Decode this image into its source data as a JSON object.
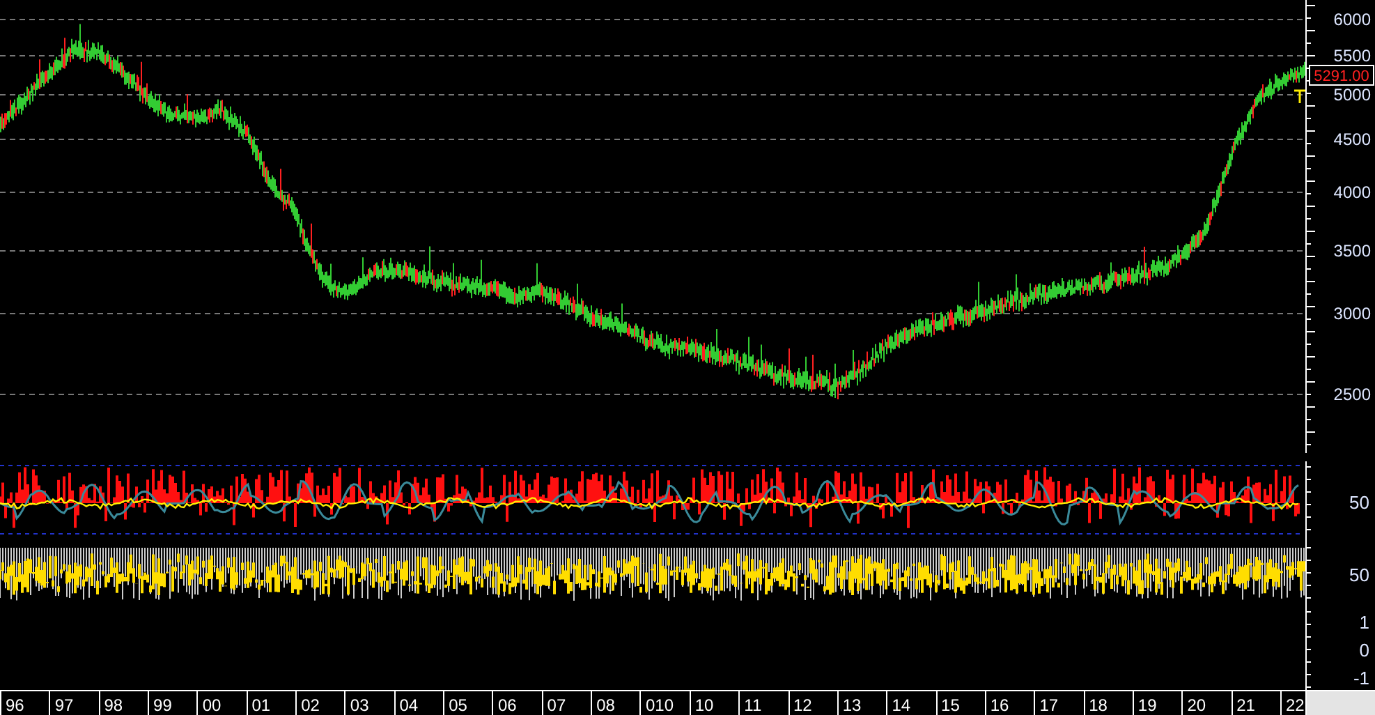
{
  "price_chart": {
    "last_price": "5291.00",
    "axis_labels": [
      "6000",
      "5500",
      "5000",
      "4500",
      "4000",
      "3500",
      "3000",
      "2500"
    ]
  },
  "oscillator_1": {
    "axis_labels": [
      "50"
    ]
  },
  "oscillator_2": {
    "axis_labels": [
      "50"
    ]
  },
  "lower_pane": {
    "axis_labels": [
      "1",
      "0",
      "-1"
    ]
  },
  "time_axis": {
    "labels": [
      "96",
      "97",
      "98",
      "99",
      "00",
      "01",
      "02",
      "03",
      "04",
      "05",
      "06",
      "07",
      "08",
      "010",
      "10",
      "11",
      "12",
      "13",
      "14",
      "15",
      "16",
      "17",
      "18",
      "19",
      "20",
      "21",
      "22"
    ]
  }
}
